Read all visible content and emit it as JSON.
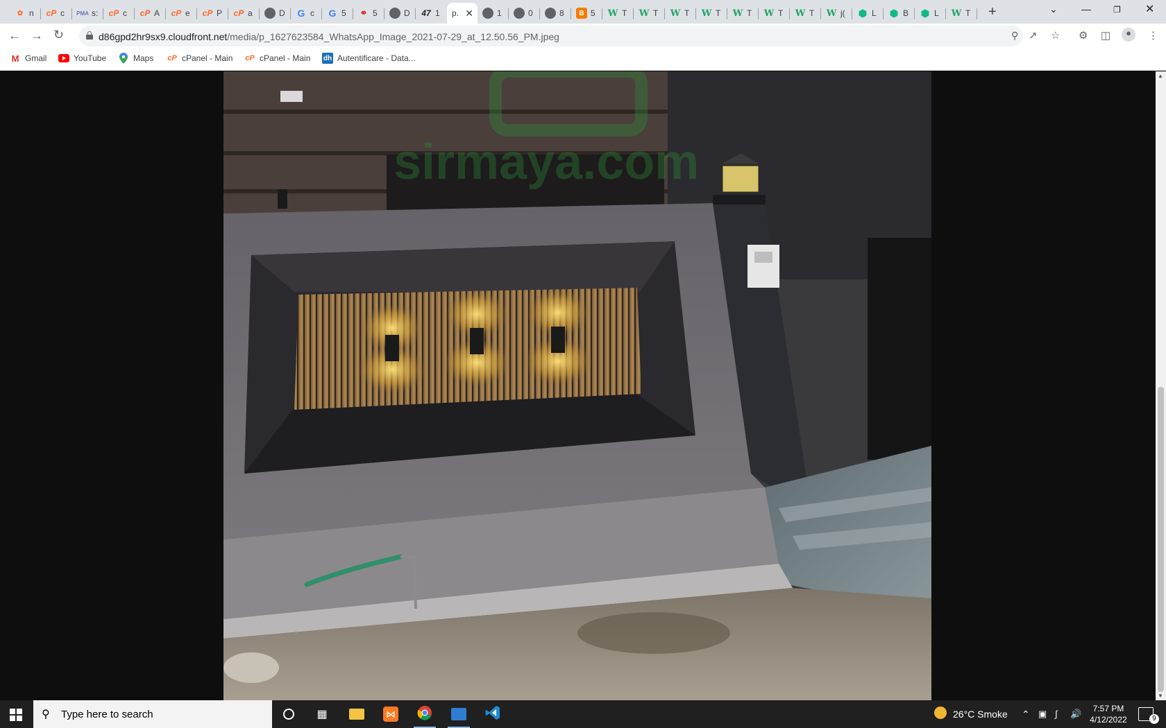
{
  "browser": {
    "tabs": [
      {
        "icon": "blogger-flame-icon",
        "label": "n"
      },
      {
        "icon": "cpanel-icon",
        "label": "c"
      },
      {
        "icon": "phpmyadmin-icon",
        "label": "s:"
      },
      {
        "icon": "cpanel-icon",
        "label": "c"
      },
      {
        "icon": "cpanel-icon",
        "label": "A"
      },
      {
        "icon": "cpanel-icon",
        "label": "e"
      },
      {
        "icon": "cpanel-icon",
        "label": "P"
      },
      {
        "icon": "cpanel-icon",
        "label": "a"
      },
      {
        "icon": "globe-icon",
        "label": "D"
      },
      {
        "icon": "google-icon",
        "label": "c"
      },
      {
        "icon": "google-icon",
        "label": "5"
      },
      {
        "icon": "red-link-icon",
        "label": "5"
      },
      {
        "icon": "globe-icon",
        "label": "D"
      },
      {
        "icon": "lf-icon",
        "label": "1"
      },
      {
        "icon": "page-icon",
        "label": "p.",
        "active": true
      },
      {
        "icon": "globe-icon",
        "label": "1"
      },
      {
        "icon": "globe-icon",
        "label": "0"
      },
      {
        "icon": "globe-icon",
        "label": "8"
      },
      {
        "icon": "blogger-icon",
        "label": "5"
      },
      {
        "icon": "w-icon",
        "label": "T"
      },
      {
        "icon": "w-icon",
        "label": "T"
      },
      {
        "icon": "w-icon",
        "label": "T"
      },
      {
        "icon": "w-icon",
        "label": "T"
      },
      {
        "icon": "w-icon",
        "label": "T"
      },
      {
        "icon": "w-icon",
        "label": "T"
      },
      {
        "icon": "w-icon",
        "label": "T"
      },
      {
        "icon": "w-icon",
        "label": "j("
      },
      {
        "icon": "hex-icon",
        "label": "L"
      },
      {
        "icon": "hex-icon",
        "label": "B"
      },
      {
        "icon": "hex-icon",
        "label": "L"
      },
      {
        "icon": "w-icon",
        "label": "T"
      }
    ],
    "new_tab": "+",
    "url_domain": "d86gpd2hr9sx9.cloudfront.net",
    "url_path": "/media/p_1627623584_WhatsApp_Image_2021-07-29_at_12.50.56_PM.jpeg",
    "bookmarks": [
      {
        "icon": "gmail-icon",
        "label": "Gmail"
      },
      {
        "icon": "youtube-icon",
        "label": "YouTube"
      },
      {
        "icon": "maps-icon",
        "label": "Maps"
      },
      {
        "icon": "cpanel-icon",
        "label": "cPanel - Main"
      },
      {
        "icon": "cpanel-icon",
        "label": "cPanel - Main"
      },
      {
        "icon": "dh-icon",
        "label": "Autentificare - Data..."
      }
    ]
  },
  "image": {
    "description_watermark": "sirmaya.com"
  },
  "taskbar": {
    "search_placeholder": "Type here to search",
    "weather": "26°C  Smoke",
    "time": "7:57 PM",
    "date": "4/12/2022",
    "notification_count": "9"
  }
}
